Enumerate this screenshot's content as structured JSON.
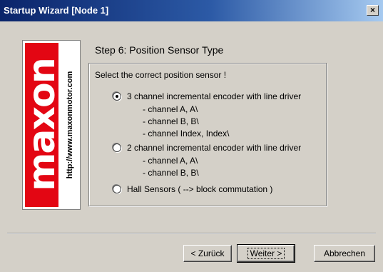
{
  "window": {
    "title": "Startup Wizard  [Node 1]",
    "close_glyph": "×"
  },
  "logo": {
    "brand": "maxon",
    "url": "http://www.maxonmotor.com"
  },
  "step": {
    "title": "Step 6: Position Sensor Type"
  },
  "group": {
    "instruction": "Select the correct position sensor !",
    "options": [
      {
        "label": "3 channel incremental encoder with line driver",
        "selected": true,
        "details": [
          "- channel A, A\\",
          "- channel B, B\\",
          "- channel Index, Index\\"
        ]
      },
      {
        "label": "2 channel incremental encoder with line driver",
        "selected": false,
        "details": [
          "- channel A, A\\",
          "- channel B, B\\"
        ]
      },
      {
        "label": "Hall Sensors ( --> block commutation )",
        "selected": false,
        "details": []
      }
    ]
  },
  "buttons": {
    "back": "< Zurück",
    "next": "Weiter >",
    "cancel": "Abbrechen"
  },
  "icons": {
    "close": "close-icon",
    "radio": "radio-icon"
  }
}
